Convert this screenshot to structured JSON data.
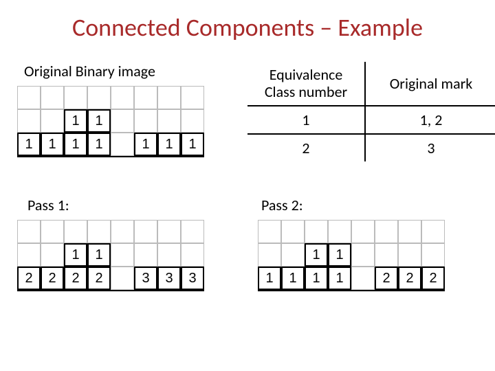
{
  "title": "Connected Components – Example",
  "labels": {
    "original": "Original Binary image",
    "pass1": "Pass 1:",
    "pass2": "Pass 2:"
  },
  "eqtable": {
    "header": {
      "ecn": "Equivalence Class number",
      "om": "Original mark"
    },
    "rows": [
      {
        "ecn": "1",
        "om": "1, 2"
      },
      {
        "ecn": "2",
        "om": "3"
      }
    ]
  },
  "grids": {
    "original": [
      [
        "",
        "",
        "",
        "",
        "",
        "",
        "",
        ""
      ],
      [
        "",
        "",
        "1",
        "1",
        "",
        "",
        "",
        ""
      ],
      [
        "1",
        "1",
        "1",
        "1",
        "",
        "1",
        "1",
        "1"
      ]
    ],
    "pass1": [
      [
        "",
        "",
        "",
        "",
        "",
        "",
        "",
        ""
      ],
      [
        "",
        "",
        "1",
        "1",
        "",
        "",
        "",
        ""
      ],
      [
        "2",
        "2",
        "2",
        "2",
        "",
        "3",
        "3",
        "3"
      ]
    ],
    "pass2": [
      [
        "",
        "",
        "",
        "",
        "",
        "",
        "",
        ""
      ],
      [
        "",
        "",
        "1",
        "1",
        "",
        "",
        "",
        ""
      ],
      [
        "1",
        "1",
        "1",
        "1",
        "",
        "2",
        "2",
        "2"
      ]
    ]
  }
}
